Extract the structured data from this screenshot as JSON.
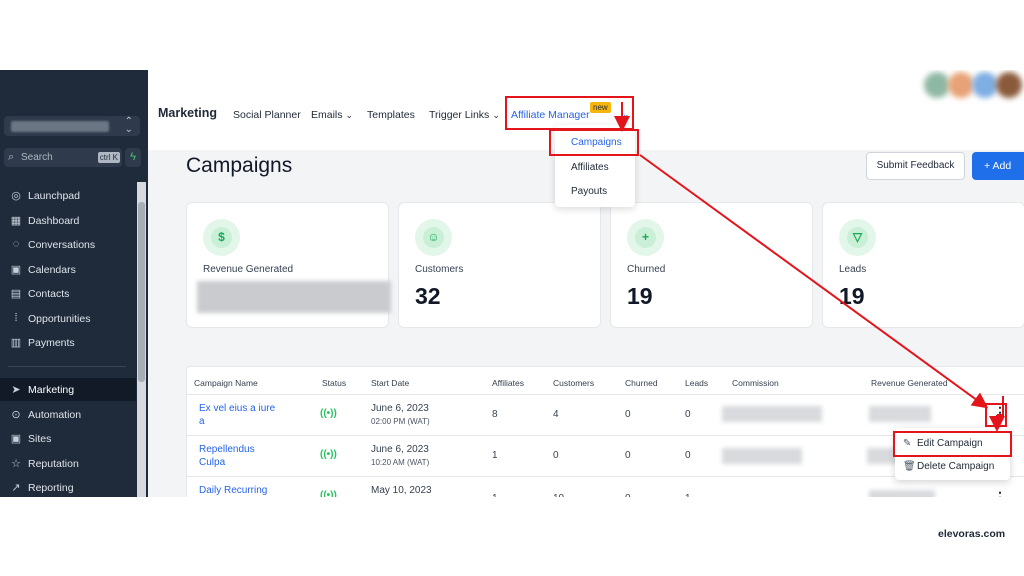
{
  "sidebar": {
    "search_placeholder": "Search",
    "search_shortcut": "ctrl K",
    "items": [
      {
        "label": "Launchpad",
        "icon": "rocket-icon"
      },
      {
        "label": "Dashboard",
        "icon": "grid-icon"
      },
      {
        "label": "Conversations",
        "icon": "chat-icon"
      },
      {
        "label": "Calendars",
        "icon": "calendar-icon"
      },
      {
        "label": "Contacts",
        "icon": "contacts-icon"
      },
      {
        "label": "Opportunities",
        "icon": "pipeline-icon"
      },
      {
        "label": "Payments",
        "icon": "payments-icon"
      },
      {
        "label": "Marketing",
        "icon": "send-icon",
        "active": true
      },
      {
        "label": "Automation",
        "icon": "automation-icon"
      },
      {
        "label": "Sites",
        "icon": "sites-icon"
      },
      {
        "label": "Reputation",
        "icon": "star-icon"
      },
      {
        "label": "Reporting",
        "icon": "chart-icon"
      }
    ]
  },
  "topnav": {
    "title": "Marketing",
    "items": [
      "Social Planner",
      "Emails",
      "Templates",
      "Trigger Links"
    ],
    "affiliate_manager": "Affiliate Manager",
    "badge": "new"
  },
  "dropdown": {
    "items": [
      "Campaigns",
      "Affiliates",
      "Payouts"
    ]
  },
  "page": {
    "title": "Campaigns",
    "feedback_button": "Submit Feedback",
    "add_button": "+ Add"
  },
  "cards": [
    {
      "label": "Revenue Generated",
      "value": "",
      "icon": "dollar-icon"
    },
    {
      "label": "Customers",
      "value": "32",
      "icon": "user-icon"
    },
    {
      "label": "Churned",
      "value": "19",
      "icon": "user-plus-icon"
    },
    {
      "label": "Leads",
      "value": "19",
      "icon": "filter-icon"
    }
  ],
  "table": {
    "headers": [
      "Campaign Name",
      "Status",
      "Start Date",
      "Affiliates",
      "Customers",
      "Churned",
      "Leads",
      "Commission",
      "Revenue Generated"
    ],
    "rows": [
      {
        "name": "Ex vel eius a iure",
        "name2": "a",
        "date": "June 6, 2023",
        "time": "02:00 PM (WAT)",
        "affiliates": "8",
        "customers": "4",
        "churned": "0",
        "leads": "0"
      },
      {
        "name": "Repellendus",
        "name2": "Culpa",
        "date": "June 6, 2023",
        "time": "10:20 AM (WAT)",
        "affiliates": "1",
        "customers": "0",
        "churned": "0",
        "leads": "0"
      },
      {
        "name": "Daily Recurring",
        "name2": "",
        "date": "May 10, 2023",
        "time": "",
        "affiliates": "1",
        "customers": "10",
        "churned": "0",
        "leads": "1"
      }
    ]
  },
  "context_menu": {
    "edit": "Edit Campaign",
    "delete": "Delete Campaign"
  },
  "watermark": "elevoras.com",
  "colors": {
    "sidebar_bg": "#1f2a3a",
    "accent_blue": "#2563eb",
    "highlight_red": "#e3151b",
    "icon_green": "#18a957",
    "badge_yellow": "#f5b50a"
  }
}
